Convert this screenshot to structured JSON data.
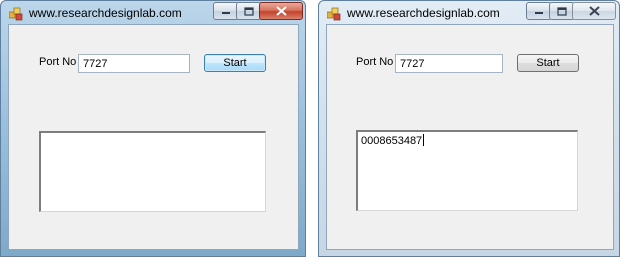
{
  "windows": [
    {
      "title": "www.researchdesignlab.com",
      "port_label": "Port No",
      "port_value": "7727",
      "start_label": "Start",
      "output_text": ""
    },
    {
      "title": "www.researchdesignlab.com",
      "port_label": "Port No",
      "port_value": "7727",
      "start_label": "Start",
      "output_text": "0008653487"
    }
  ],
  "icons": {
    "app": "app-icon",
    "minimize": "minimize-icon",
    "maximize": "maximize-icon",
    "close": "close-icon"
  },
  "colors": {
    "client_bg": "#f0f0f0",
    "close_active": "#c4432b"
  }
}
